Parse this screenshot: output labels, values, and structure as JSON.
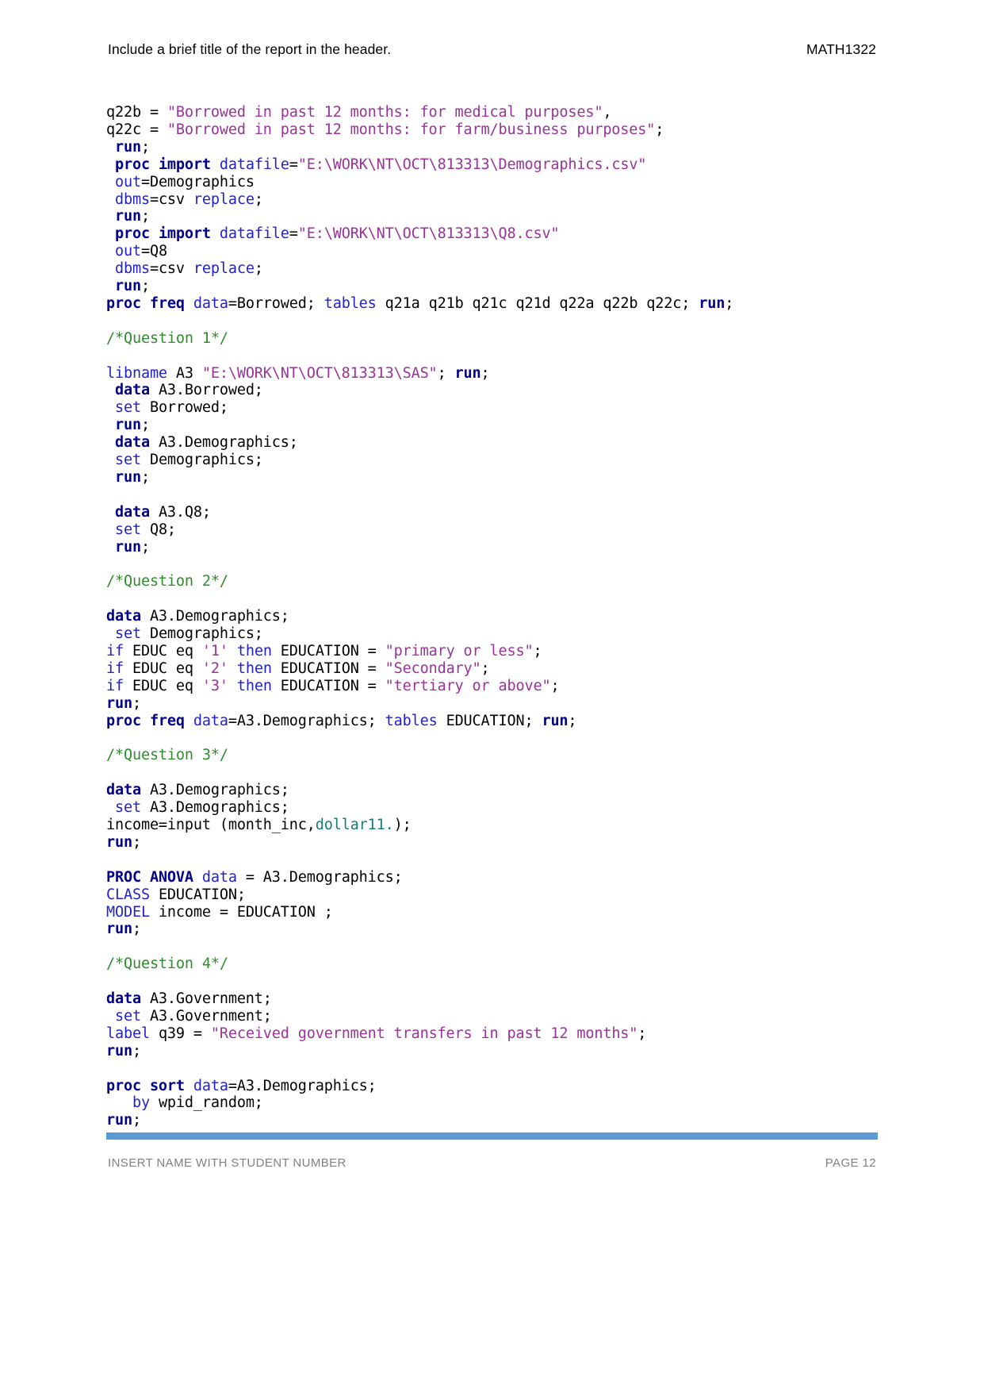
{
  "header": {
    "title": "Include a brief title of the report in the header.",
    "course_code": "MATH1322"
  },
  "footer": {
    "student_placeholder": "INSERT NAME WITH STUDENT NUMBER",
    "page_label": "PAGE 12",
    "rule_color": "#5b9bd5"
  },
  "colors": {
    "statement_keyword": "#00008b",
    "option_keyword": "#2222cc",
    "string_literal": "#993399",
    "comment": "#2e8b2e",
    "format_literal": "#157a7a",
    "plain_text": "#000000"
  },
  "code": {
    "language": "SAS",
    "lines": [
      {
        "id": "l01",
        "tokens": [
          {
            "t": "q22b = ",
            "c": "plain"
          },
          {
            "t": "\"Borrowed in past 12 months: for medical purposes\"",
            "c": "str"
          },
          {
            "t": ",",
            "c": "plain"
          }
        ]
      },
      {
        "id": "l02",
        "tokens": [
          {
            "t": "q22c = ",
            "c": "plain"
          },
          {
            "t": "\"Borrowed in past 12 months: for farm/business purposes\"",
            "c": "str"
          },
          {
            "t": ";",
            "c": "plain"
          }
        ]
      },
      {
        "id": "l03",
        "tokens": [
          {
            "t": " ",
            "c": "plain"
          },
          {
            "t": "run",
            "c": "stmt"
          },
          {
            "t": ";",
            "c": "plain"
          }
        ]
      },
      {
        "id": "l04",
        "tokens": [
          {
            "t": " ",
            "c": "plain"
          },
          {
            "t": "proc import",
            "c": "stmt"
          },
          {
            "t": " ",
            "c": "plain"
          },
          {
            "t": "datafile",
            "c": "opt"
          },
          {
            "t": "=",
            "c": "plain"
          },
          {
            "t": "\"E:\\WORK\\NT\\OCT\\813313\\Demographics.csv\"",
            "c": "str"
          }
        ]
      },
      {
        "id": "l05",
        "tokens": [
          {
            "t": " ",
            "c": "plain"
          },
          {
            "t": "out",
            "c": "opt"
          },
          {
            "t": "=Demographics",
            "c": "plain"
          }
        ]
      },
      {
        "id": "l06",
        "tokens": [
          {
            "t": " ",
            "c": "plain"
          },
          {
            "t": "dbms",
            "c": "opt"
          },
          {
            "t": "=csv ",
            "c": "plain"
          },
          {
            "t": "replace",
            "c": "opt"
          },
          {
            "t": ";",
            "c": "plain"
          }
        ]
      },
      {
        "id": "l07",
        "tokens": [
          {
            "t": " ",
            "c": "plain"
          },
          {
            "t": "run",
            "c": "stmt"
          },
          {
            "t": ";",
            "c": "plain"
          }
        ]
      },
      {
        "id": "l08",
        "tokens": [
          {
            "t": " ",
            "c": "plain"
          },
          {
            "t": "proc import",
            "c": "stmt"
          },
          {
            "t": " ",
            "c": "plain"
          },
          {
            "t": "datafile",
            "c": "opt"
          },
          {
            "t": "=",
            "c": "plain"
          },
          {
            "t": "\"E:\\WORK\\NT\\OCT\\813313\\Q8.csv\"",
            "c": "str"
          }
        ]
      },
      {
        "id": "l09",
        "tokens": [
          {
            "t": " ",
            "c": "plain"
          },
          {
            "t": "out",
            "c": "opt"
          },
          {
            "t": "=Q8",
            "c": "plain"
          }
        ]
      },
      {
        "id": "l10",
        "tokens": [
          {
            "t": " ",
            "c": "plain"
          },
          {
            "t": "dbms",
            "c": "opt"
          },
          {
            "t": "=csv ",
            "c": "plain"
          },
          {
            "t": "replace",
            "c": "opt"
          },
          {
            "t": ";",
            "c": "plain"
          }
        ]
      },
      {
        "id": "l11",
        "tokens": [
          {
            "t": " ",
            "c": "plain"
          },
          {
            "t": "run",
            "c": "stmt"
          },
          {
            "t": ";",
            "c": "plain"
          }
        ]
      },
      {
        "id": "l12",
        "tokens": [
          {
            "t": "proc freq",
            "c": "stmt"
          },
          {
            "t": " ",
            "c": "plain"
          },
          {
            "t": "data",
            "c": "opt"
          },
          {
            "t": "=Borrowed; ",
            "c": "plain"
          },
          {
            "t": "tables",
            "c": "opt"
          },
          {
            "t": " q21a q21b q21c q21d q22a q22b q22c; ",
            "c": "plain"
          },
          {
            "t": "run",
            "c": "stmt"
          },
          {
            "t": ";",
            "c": "plain"
          }
        ]
      },
      {
        "id": "l13",
        "blank": true,
        "tokens": []
      },
      {
        "id": "l14",
        "tokens": [
          {
            "t": "/*Question 1*/",
            "c": "cmt"
          }
        ]
      },
      {
        "id": "l15",
        "blank": true,
        "tokens": []
      },
      {
        "id": "l16",
        "tokens": [
          {
            "t": "libname",
            "c": "opt"
          },
          {
            "t": " A3 ",
            "c": "plain"
          },
          {
            "t": "\"E:\\WORK\\NT\\OCT\\813313\\SAS\"",
            "c": "str"
          },
          {
            "t": "; ",
            "c": "plain"
          },
          {
            "t": "run",
            "c": "stmt"
          },
          {
            "t": ";",
            "c": "plain"
          }
        ]
      },
      {
        "id": "l17",
        "tokens": [
          {
            "t": " ",
            "c": "plain"
          },
          {
            "t": "data",
            "c": "stmt"
          },
          {
            "t": " A3.Borrowed;",
            "c": "plain"
          }
        ]
      },
      {
        "id": "l18",
        "tokens": [
          {
            "t": " ",
            "c": "plain"
          },
          {
            "t": "set",
            "c": "opt"
          },
          {
            "t": " Borrowed;",
            "c": "plain"
          }
        ]
      },
      {
        "id": "l19",
        "tokens": [
          {
            "t": " ",
            "c": "plain"
          },
          {
            "t": "run",
            "c": "stmt"
          },
          {
            "t": ";",
            "c": "plain"
          }
        ]
      },
      {
        "id": "l20",
        "tokens": [
          {
            "t": " ",
            "c": "plain"
          },
          {
            "t": "data",
            "c": "stmt"
          },
          {
            "t": " A3.Demographics;",
            "c": "plain"
          }
        ]
      },
      {
        "id": "l21",
        "tokens": [
          {
            "t": " ",
            "c": "plain"
          },
          {
            "t": "set",
            "c": "opt"
          },
          {
            "t": " Demographics;",
            "c": "plain"
          }
        ]
      },
      {
        "id": "l22",
        "tokens": [
          {
            "t": " ",
            "c": "plain"
          },
          {
            "t": "run",
            "c": "stmt"
          },
          {
            "t": ";",
            "c": "plain"
          }
        ]
      },
      {
        "id": "l23",
        "blank": true,
        "tokens": []
      },
      {
        "id": "l24",
        "tokens": [
          {
            "t": " ",
            "c": "plain"
          },
          {
            "t": "data",
            "c": "stmt"
          },
          {
            "t": " A3.Q8;",
            "c": "plain"
          }
        ]
      },
      {
        "id": "l25",
        "tokens": [
          {
            "t": " ",
            "c": "plain"
          },
          {
            "t": "set",
            "c": "opt"
          },
          {
            "t": " Q8;",
            "c": "plain"
          }
        ]
      },
      {
        "id": "l26",
        "tokens": [
          {
            "t": " ",
            "c": "plain"
          },
          {
            "t": "run",
            "c": "stmt"
          },
          {
            "t": ";",
            "c": "plain"
          }
        ]
      },
      {
        "id": "l27",
        "blank": true,
        "tokens": []
      },
      {
        "id": "l28",
        "tokens": [
          {
            "t": "/*Question 2*/",
            "c": "cmt"
          }
        ]
      },
      {
        "id": "l29",
        "blank": true,
        "tokens": []
      },
      {
        "id": "l30",
        "tokens": [
          {
            "t": "data",
            "c": "stmt"
          },
          {
            "t": " A3.Demographics;",
            "c": "plain"
          }
        ]
      },
      {
        "id": "l31",
        "tokens": [
          {
            "t": " ",
            "c": "plain"
          },
          {
            "t": "set",
            "c": "opt"
          },
          {
            "t": " Demographics;",
            "c": "plain"
          }
        ]
      },
      {
        "id": "l32",
        "tokens": [
          {
            "t": "if",
            "c": "opt"
          },
          {
            "t": " EDUC eq ",
            "c": "plain"
          },
          {
            "t": "'1'",
            "c": "str"
          },
          {
            "t": " ",
            "c": "plain"
          },
          {
            "t": "then",
            "c": "opt"
          },
          {
            "t": " EDUCATION = ",
            "c": "plain"
          },
          {
            "t": "\"primary or less\"",
            "c": "str"
          },
          {
            "t": ";",
            "c": "plain"
          }
        ]
      },
      {
        "id": "l33",
        "tokens": [
          {
            "t": "if",
            "c": "opt"
          },
          {
            "t": " EDUC eq ",
            "c": "plain"
          },
          {
            "t": "'2'",
            "c": "str"
          },
          {
            "t": " ",
            "c": "plain"
          },
          {
            "t": "then",
            "c": "opt"
          },
          {
            "t": " EDUCATION = ",
            "c": "plain"
          },
          {
            "t": "\"Secondary\"",
            "c": "str"
          },
          {
            "t": ";",
            "c": "plain"
          }
        ]
      },
      {
        "id": "l34",
        "tokens": [
          {
            "t": "if",
            "c": "opt"
          },
          {
            "t": " EDUC eq ",
            "c": "plain"
          },
          {
            "t": "'3'",
            "c": "str"
          },
          {
            "t": " ",
            "c": "plain"
          },
          {
            "t": "then",
            "c": "opt"
          },
          {
            "t": " EDUCATION = ",
            "c": "plain"
          },
          {
            "t": "\"tertiary or above\"",
            "c": "str"
          },
          {
            "t": ";",
            "c": "plain"
          }
        ]
      },
      {
        "id": "l35",
        "tokens": [
          {
            "t": "run",
            "c": "stmt"
          },
          {
            "t": ";",
            "c": "plain"
          }
        ]
      },
      {
        "id": "l36",
        "tokens": [
          {
            "t": "proc freq",
            "c": "stmt"
          },
          {
            "t": " ",
            "c": "plain"
          },
          {
            "t": "data",
            "c": "opt"
          },
          {
            "t": "=A3.Demographics; ",
            "c": "plain"
          },
          {
            "t": "tables",
            "c": "opt"
          },
          {
            "t": " EDUCATION; ",
            "c": "plain"
          },
          {
            "t": "run",
            "c": "stmt"
          },
          {
            "t": ";",
            "c": "plain"
          }
        ]
      },
      {
        "id": "l37",
        "blank": true,
        "tokens": []
      },
      {
        "id": "l38",
        "tokens": [
          {
            "t": "/*Question 3*/",
            "c": "cmt"
          }
        ]
      },
      {
        "id": "l39",
        "blank": true,
        "tokens": []
      },
      {
        "id": "l40",
        "tokens": [
          {
            "t": "data",
            "c": "stmt"
          },
          {
            "t": " A3.Demographics;",
            "c": "plain"
          }
        ]
      },
      {
        "id": "l41",
        "tokens": [
          {
            "t": " ",
            "c": "plain"
          },
          {
            "t": "set",
            "c": "opt"
          },
          {
            "t": " A3.Demographics;",
            "c": "plain"
          }
        ]
      },
      {
        "id": "l42",
        "tokens": [
          {
            "t": "income=input (month_inc,",
            "c": "plain"
          },
          {
            "t": "dollar11.",
            "c": "fmt"
          },
          {
            "t": ");",
            "c": "plain"
          }
        ]
      },
      {
        "id": "l43",
        "tokens": [
          {
            "t": "run",
            "c": "stmt"
          },
          {
            "t": ";",
            "c": "plain"
          }
        ]
      },
      {
        "id": "l44",
        "blank": true,
        "tokens": []
      },
      {
        "id": "l45",
        "tokens": [
          {
            "t": "PROC ANOVA",
            "c": "stmt"
          },
          {
            "t": " ",
            "c": "plain"
          },
          {
            "t": "data",
            "c": "opt"
          },
          {
            "t": " = A3.Demographics;",
            "c": "plain"
          }
        ]
      },
      {
        "id": "l46",
        "tokens": [
          {
            "t": "CLASS",
            "c": "opt"
          },
          {
            "t": " EDUCATION;",
            "c": "plain"
          }
        ]
      },
      {
        "id": "l47",
        "tokens": [
          {
            "t": "MODEL",
            "c": "opt"
          },
          {
            "t": " income = EDUCATION ;",
            "c": "plain"
          }
        ]
      },
      {
        "id": "l48",
        "tokens": [
          {
            "t": "run",
            "c": "stmt"
          },
          {
            "t": ";",
            "c": "plain"
          }
        ]
      },
      {
        "id": "l49",
        "blank": true,
        "tokens": []
      },
      {
        "id": "l50",
        "tokens": [
          {
            "t": "/*Question 4*/",
            "c": "cmt"
          }
        ]
      },
      {
        "id": "l51",
        "blank": true,
        "tokens": []
      },
      {
        "id": "l52",
        "tokens": [
          {
            "t": "data",
            "c": "stmt"
          },
          {
            "t": " A3.Government;",
            "c": "plain"
          }
        ]
      },
      {
        "id": "l53",
        "tokens": [
          {
            "t": " ",
            "c": "plain"
          },
          {
            "t": "set",
            "c": "opt"
          },
          {
            "t": " A3.Government;",
            "c": "plain"
          }
        ]
      },
      {
        "id": "l54",
        "tokens": [
          {
            "t": "label",
            "c": "opt"
          },
          {
            "t": " q39 = ",
            "c": "plain"
          },
          {
            "t": "\"Received government transfers in past 12 months\"",
            "c": "str"
          },
          {
            "t": ";",
            "c": "plain"
          }
        ]
      },
      {
        "id": "l55",
        "tokens": [
          {
            "t": "run",
            "c": "stmt"
          },
          {
            "t": ";",
            "c": "plain"
          }
        ]
      },
      {
        "id": "l56",
        "blank": true,
        "tokens": []
      },
      {
        "id": "l57",
        "tokens": [
          {
            "t": "proc sort",
            "c": "stmt"
          },
          {
            "t": " ",
            "c": "plain"
          },
          {
            "t": "data",
            "c": "opt"
          },
          {
            "t": "=A3.Demographics;",
            "c": "plain"
          }
        ]
      },
      {
        "id": "l58",
        "tokens": [
          {
            "t": "   ",
            "c": "plain"
          },
          {
            "t": "by",
            "c": "opt"
          },
          {
            "t": " wpid_random;",
            "c": "plain"
          }
        ]
      },
      {
        "id": "l59",
        "tokens": [
          {
            "t": "run",
            "c": "stmt"
          },
          {
            "t": ";",
            "c": "plain"
          }
        ]
      }
    ]
  }
}
